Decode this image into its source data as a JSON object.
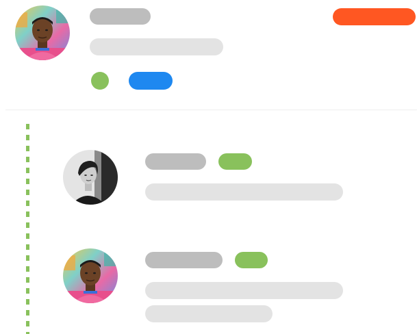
{
  "colors": {
    "name_placeholder": "#bdbdbd",
    "line_placeholder": "#e3e3e3",
    "accent_orange": "#ff5722",
    "accent_blue": "#1e88f0",
    "accent_green": "#89c15c",
    "thread_line": "#89c15c"
  },
  "post": {
    "avatar_icon": "user-avatar-man-colorful-shirt",
    "badge_orange": "orange-status-pill",
    "dot_green": "green-status-dot",
    "tag_blue": "blue-tag-pill"
  },
  "replies": [
    {
      "avatar_icon": "user-avatar-woman-monochrome",
      "badge": "green-tag-pill"
    },
    {
      "avatar_icon": "user-avatar-man-colorful-shirt",
      "badge": "green-tag-pill"
    }
  ]
}
